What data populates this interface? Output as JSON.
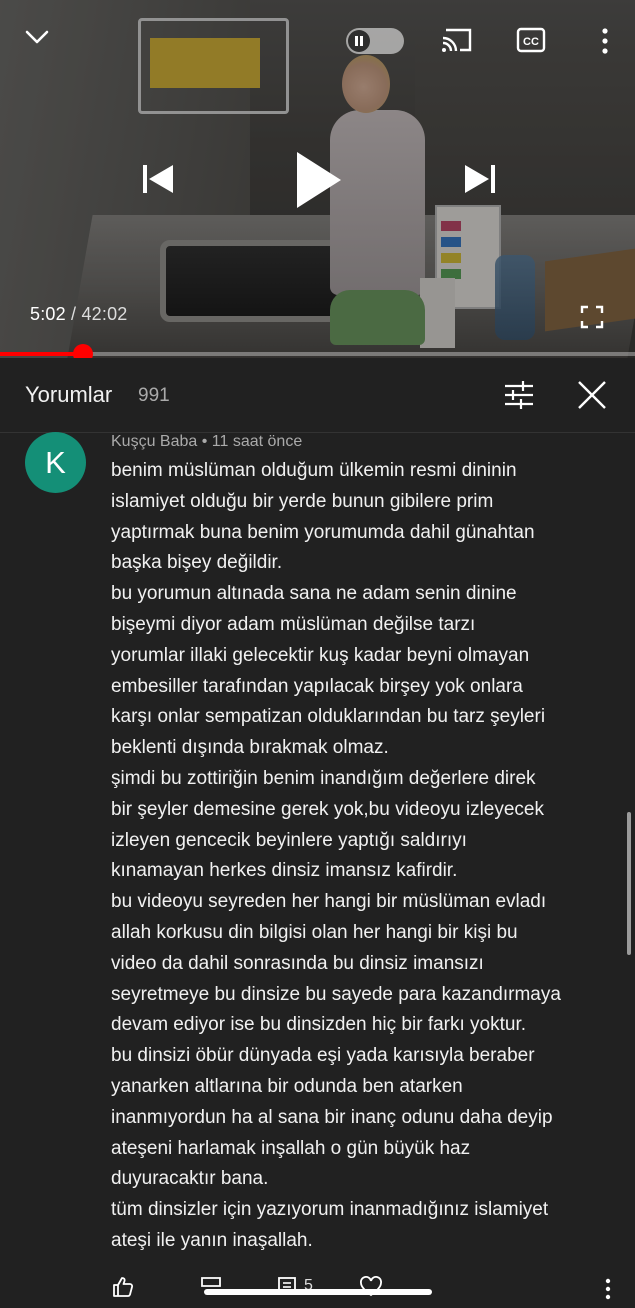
{
  "player": {
    "current_time": "5:02",
    "separator": "/",
    "duration": "42:02",
    "progress_fraction": 0.131,
    "icons": {
      "minimize": "chevron-down-icon",
      "autoplay": "pause-toggle-icon",
      "cast": "cast-icon",
      "captions": "cc-icon",
      "more": "more-vert-icon",
      "previous": "skip-previous-icon",
      "play": "play-icon",
      "next": "skip-next-icon",
      "fullscreen": "fullscreen-icon"
    },
    "progress_color": "#ff0000"
  },
  "comments_panel": {
    "title": "Yorumlar",
    "count": "991",
    "icons": {
      "filter": "sort-filter-icon",
      "close": "close-icon"
    }
  },
  "comment": {
    "avatar_letter": "K",
    "avatar_color": "#148f77",
    "meta": "Kuşçu Baba • 11 saat önce",
    "lines": [
      "benim müslüman olduğum ülkemin resmi dininin",
      "islamiyet olduğu bir yerde bunun gibilere prim",
      "yaptırmak buna benim yorumumda dahil günahtan",
      "başka bişey değildir.",
      "bu yorumun altınada sana ne adam senin dinine",
      "bişeymi diyor adam müslüman değilse tarzı",
      "yorumlar illaki gelecektir kuş kadar beyni olmayan",
      "embesiller tarafından yapılacak birşey yok onlara",
      "karşı onlar sempatizan olduklarından bu tarz şeyleri",
      "beklenti dışında bırakmak olmaz.",
      "şimdi bu zottiriğin benim inandığım değerlere direk",
      "bir şeyler demesine gerek yok,bu videoyu izleyecek",
      "izleyen gencecik beyinlere yaptığı saldırıyı",
      "kınamayan herkes dinsiz imansız kafirdir.",
      "bu videoyu seyreden her hangi bir müslüman evladı",
      "allah korkusu din bilgisi olan her hangi bir kişi bu",
      "video da dahil sonrasında bu dinsiz imansızı",
      "seyretmeye bu dinsize bu sayede para kazandırmaya",
      "devam ediyor ise bu dinsizden hiç bir farkı yoktur.",
      "bu dinsizi öbür dünyada eşi yada karısıyla beraber",
      "yanarken altlarına bir odunda ben atarken",
      "inanmıyordun ha al sana bir inanç odunu daha deyip",
      "ateşeni harlamak inşallah o gün büyük haz",
      "duyuracaktır bana.",
      "tüm dinsizler için yazıyorum inanmadığınız islamiyet",
      "ateşi ile yanın inaşallah."
    ],
    "actions": {
      "like_icon": "thumb-up-icon",
      "dislike_icon": "thumb-down-icon",
      "reply_icon": "comment-reply-icon",
      "reply_count": "5",
      "heart_icon": "heart-icon",
      "more_icon": "more-vert-icon"
    }
  }
}
